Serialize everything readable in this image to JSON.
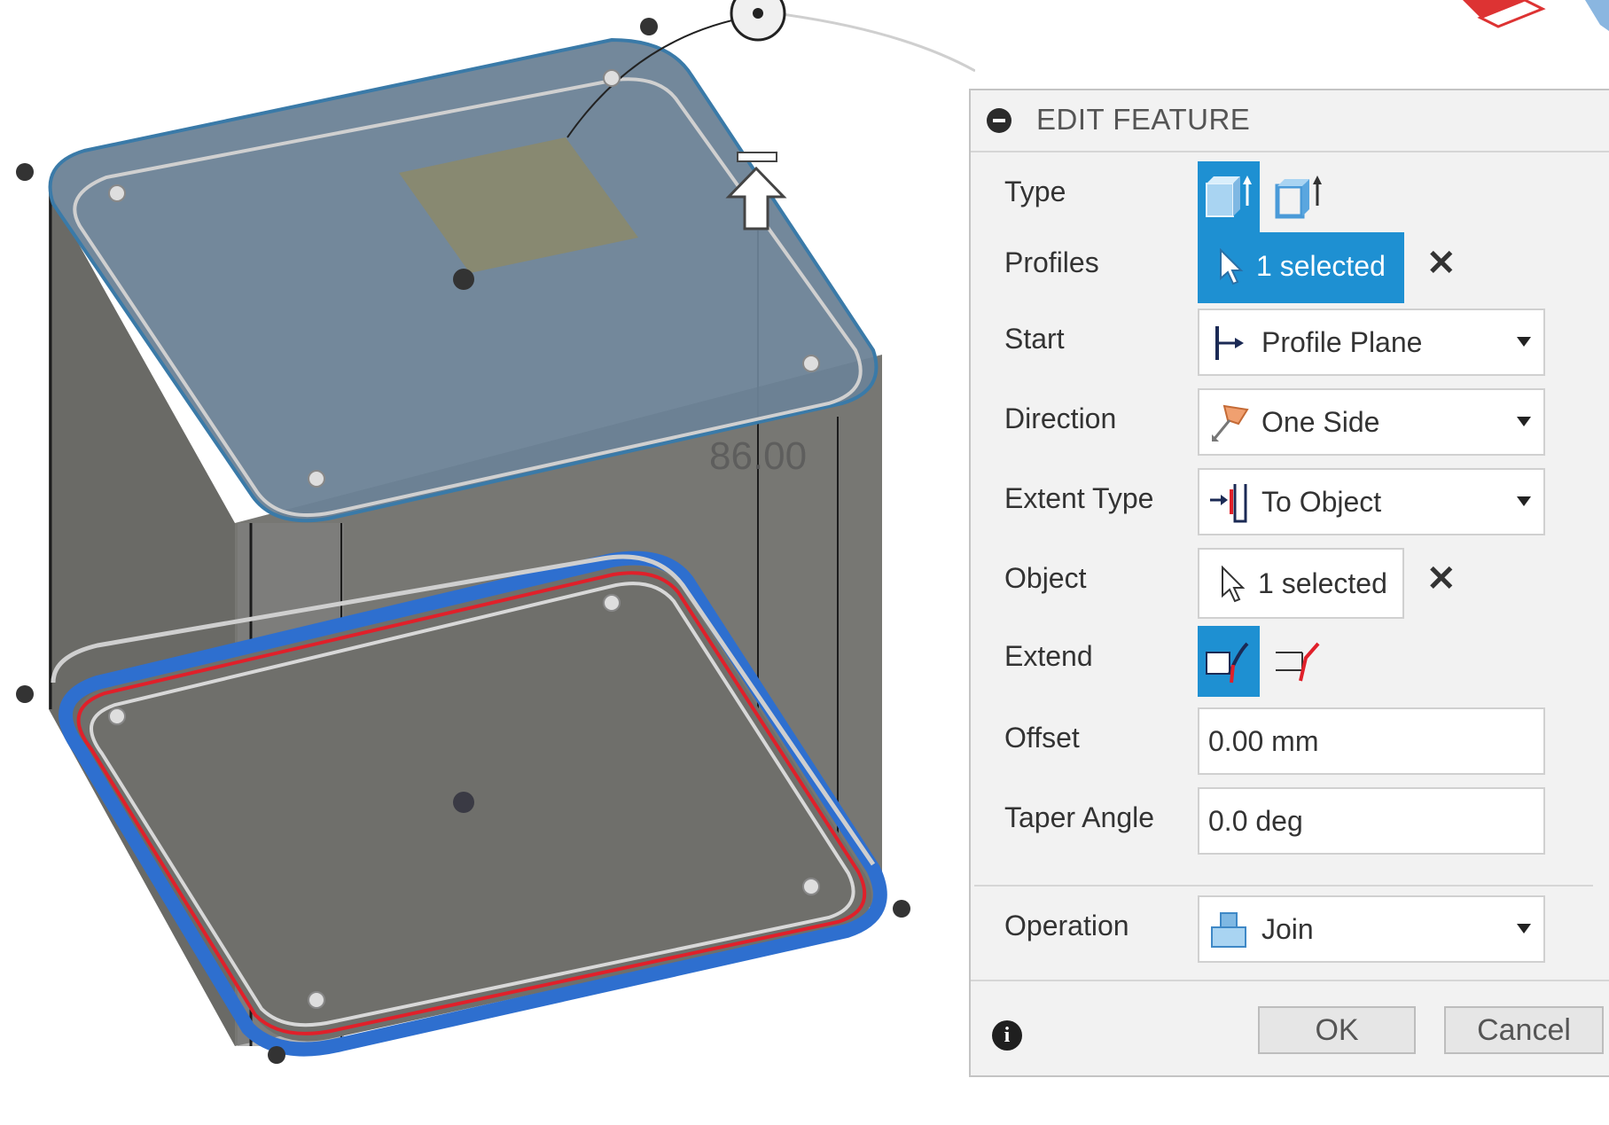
{
  "viewport": {
    "dimension_label": "86.00"
  },
  "panel": {
    "title": "EDIT FEATURE",
    "rows": {
      "type": {
        "label": "Type",
        "options": [
          "extrude-solid-icon",
          "extrude-thin-icon"
        ],
        "selected_index": 0
      },
      "profiles": {
        "label": "Profiles",
        "value": "1 selected"
      },
      "start": {
        "label": "Start",
        "value": "Profile Plane"
      },
      "direction": {
        "label": "Direction",
        "value": "One Side"
      },
      "extent_type": {
        "label": "Extent Type",
        "value": "To Object"
      },
      "object": {
        "label": "Object",
        "value": "1 selected"
      },
      "extend": {
        "label": "Extend",
        "options": [
          "extend-smooth-icon",
          "extend-adjacent-icon"
        ],
        "selected_index": 0
      },
      "offset": {
        "label": "Offset",
        "value": "0.00 mm"
      },
      "taper_angle": {
        "label": "Taper Angle",
        "value": "0.0 deg"
      },
      "operation": {
        "label": "Operation",
        "value": "Join"
      }
    },
    "buttons": {
      "ok": "OK",
      "cancel": "Cancel"
    }
  },
  "colors": {
    "accent": "#1e90d2",
    "panel_bg": "#f2f2f2",
    "profile_outline": "#2e6fcf",
    "edge_highlight": "#e0202a"
  }
}
